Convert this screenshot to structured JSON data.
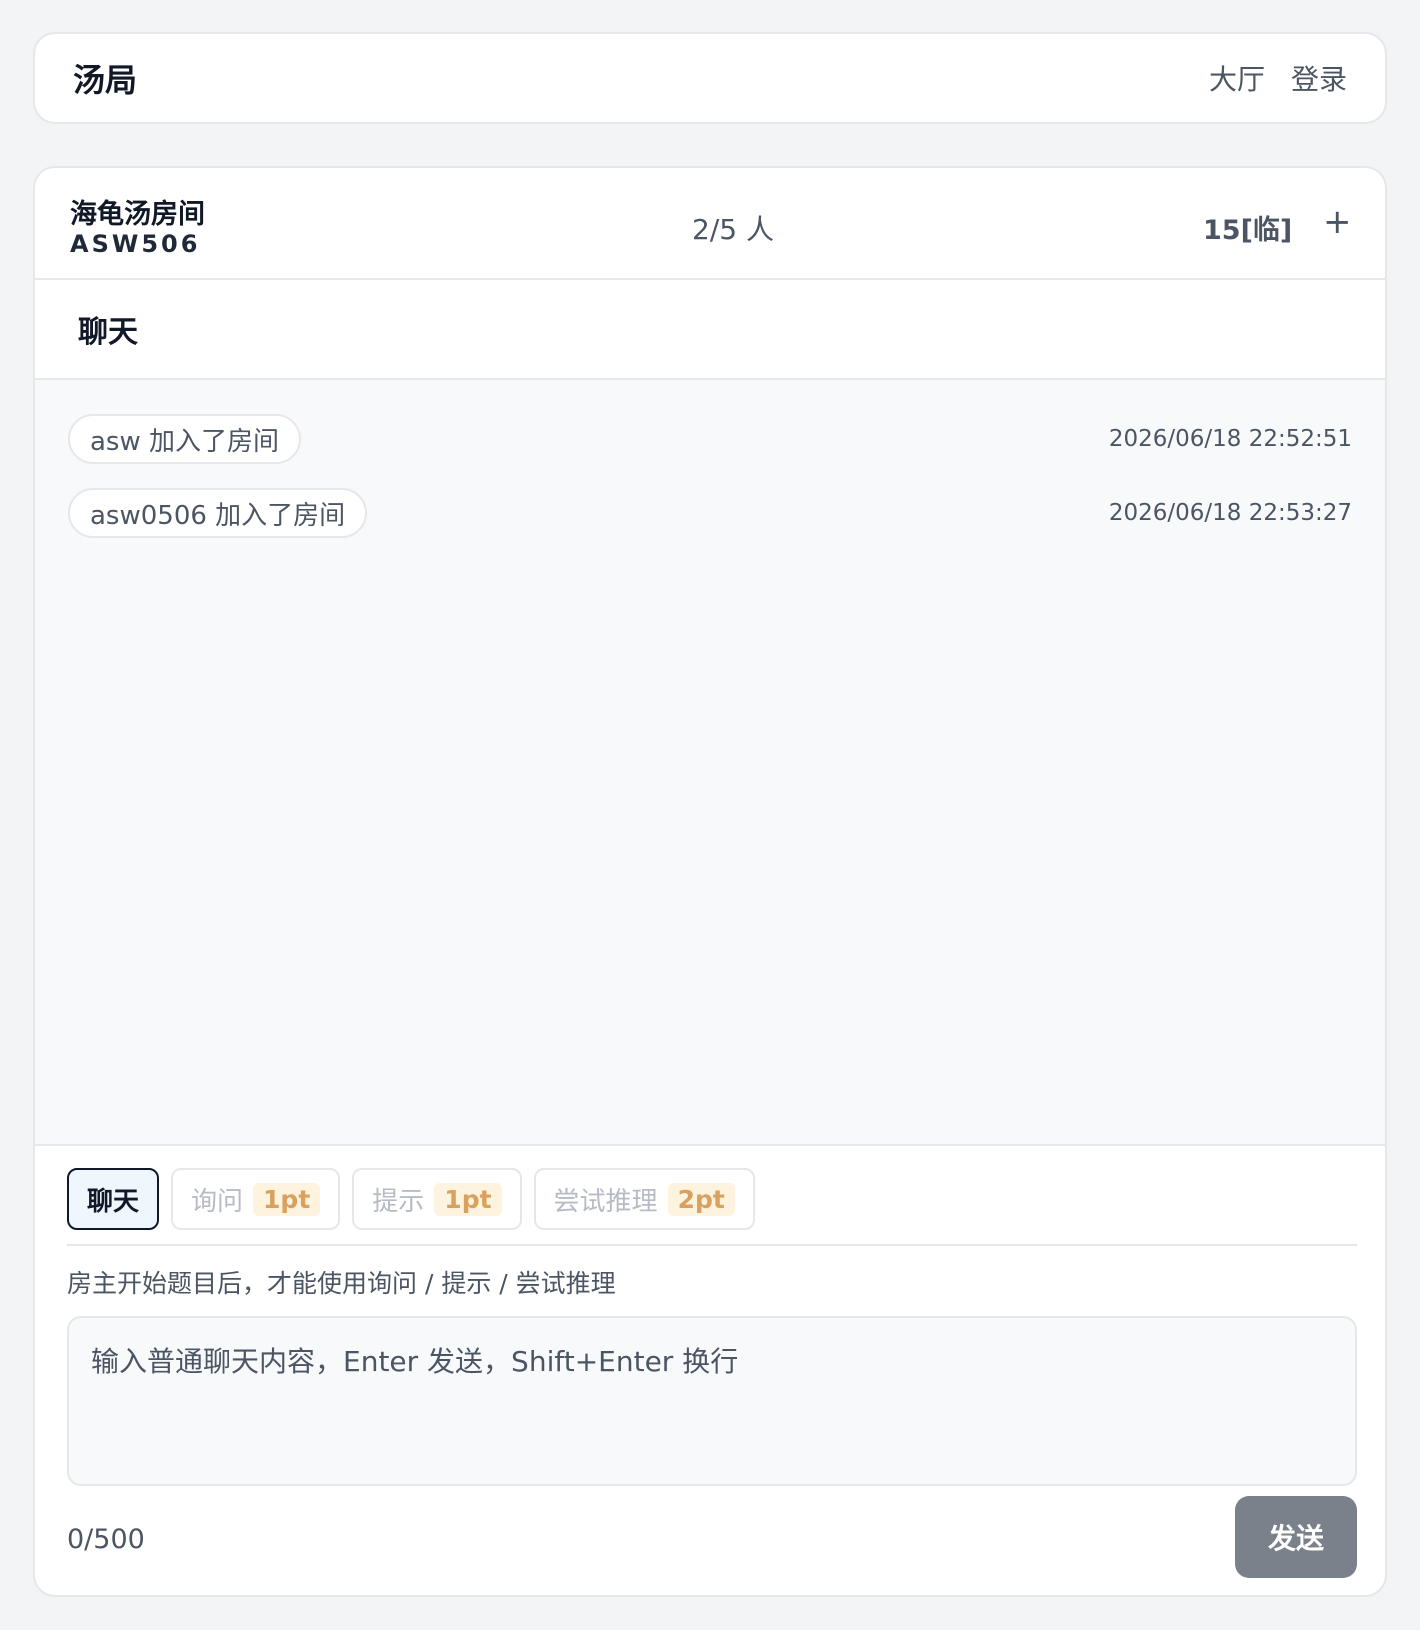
{
  "header": {
    "brand": "汤局",
    "nav": [
      "大厅",
      "登录"
    ]
  },
  "room": {
    "title": "海龟汤房间",
    "code": "ASW506",
    "count": "2/5 人",
    "points": "15[临]",
    "add_label": "+"
  },
  "chat": {
    "title": "聊天",
    "messages": [
      {
        "text": "asw 加入了房间",
        "time": "2026/06/18 22:52:51"
      },
      {
        "text": "asw0506 加入了房间",
        "time": "2026/06/18 22:53:27"
      }
    ]
  },
  "composer": {
    "modes": [
      {
        "label": "聊天",
        "cost": "",
        "active": true
      },
      {
        "label": "询问",
        "cost": "1pt",
        "active": false
      },
      {
        "label": "提示",
        "cost": "1pt",
        "active": false
      },
      {
        "label": "尝试推理",
        "cost": "2pt",
        "active": false
      }
    ],
    "hint": "房主开始题目后，才能使用询问 / 提示 / 尝试推理",
    "placeholder": "输入普通聊天内容，Enter 发送，Shift+Enter 换行",
    "counter": "0/500",
    "send_label": "发送"
  },
  "colors": {
    "active_mode_bg": "#eef7fd",
    "cost_bg": "#fdf3de",
    "cost_text": "#d9a05f",
    "send_bg": "#7b818b"
  }
}
